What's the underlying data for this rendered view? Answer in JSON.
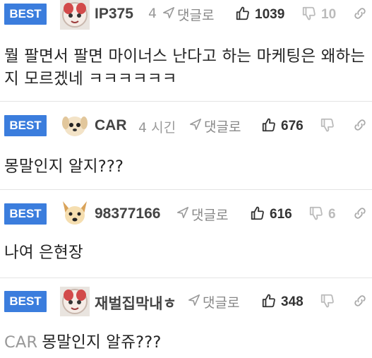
{
  "ui": {
    "best_label": "BEST",
    "reply_label": "댓글로"
  },
  "comments": [
    {
      "nickname": "IP375",
      "time": "4",
      "upvotes": "1039",
      "downvotes": "10",
      "avatar_icon": "plush-doll-avatar",
      "text": "뭘 팔면서 팔면 마이너스 난다고 하는 마케팅은 왜하는지 모르겠네 ㅋㅋㅋㅋㅋㅋ"
    },
    {
      "nickname": "CAR",
      "time": "4 시긴",
      "upvotes": "676",
      "downvotes": "",
      "avatar_icon": "puppy-avatar",
      "text": "몽말인지 알지???"
    },
    {
      "nickname": "98377166",
      "time": "",
      "upvotes": "616",
      "downvotes": "6",
      "avatar_icon": "cartoon-dog-avatar",
      "text": "나여 은현장"
    },
    {
      "nickname": "재벌집막내ㅎ",
      "time": "",
      "upvotes": "348",
      "downvotes": "",
      "avatar_icon": "plush-doll-avatar",
      "mention": "CAR",
      "text": "몽말인지 알쥬???"
    }
  ]
}
